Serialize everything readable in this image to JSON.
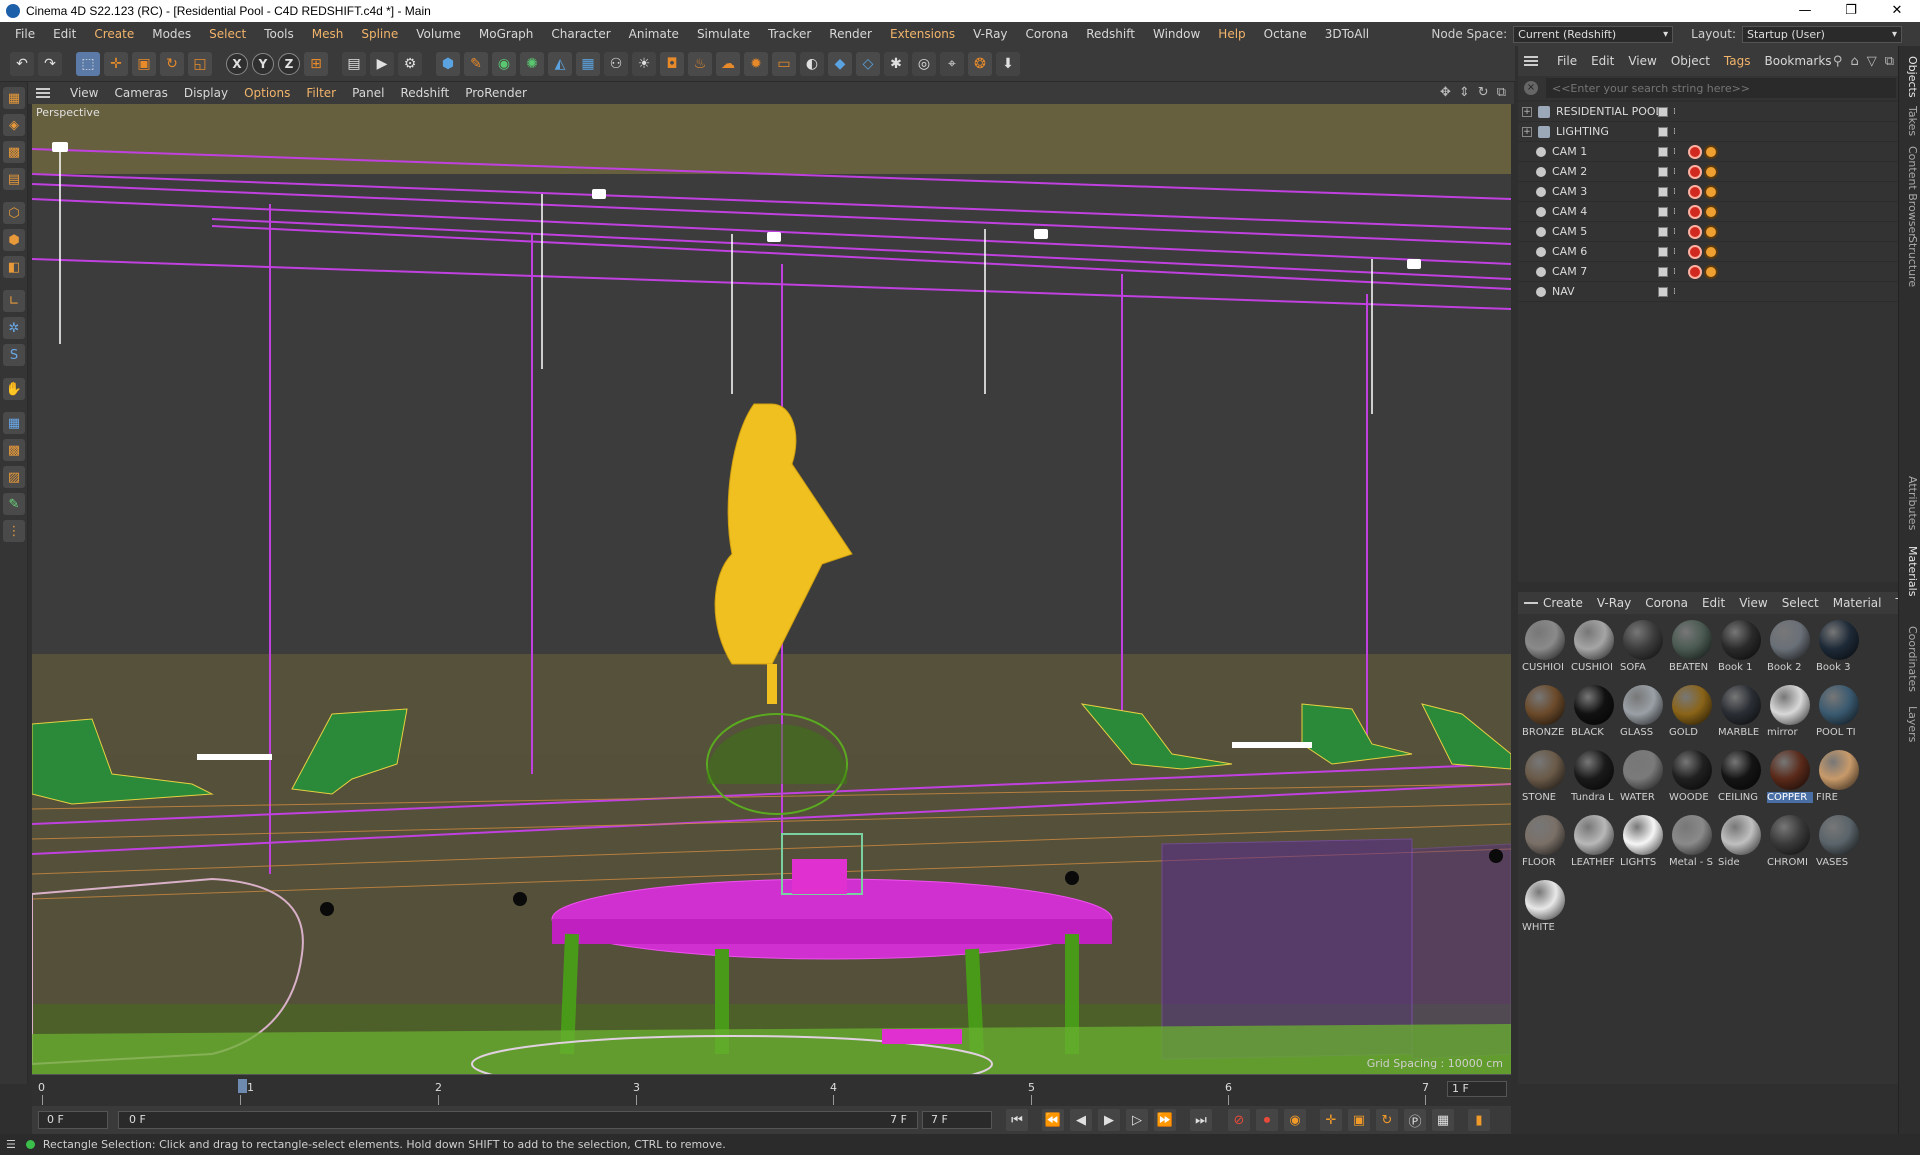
{
  "window": {
    "title": "Cinema 4D S22.123 (RC) - [Residential Pool - C4D REDSHIFT.c4d *] - Main",
    "controls": [
      "—",
      "❐",
      "✕"
    ]
  },
  "menubar": {
    "items": [
      "File",
      "Edit",
      "Create",
      "Modes",
      "Select",
      "Tools",
      "Mesh",
      "Spline",
      "Volume",
      "MoGraph",
      "Character",
      "Animate",
      "Simulate",
      "Tracker",
      "Render",
      "Extensions",
      "V-Ray",
      "Corona",
      "Redshift",
      "Window",
      "Help",
      "Octane",
      "3DToAll"
    ],
    "node_space_label": "Node Space:",
    "node_space_value": "Current (Redshift)",
    "layout_label": "Layout:",
    "layout_value": "Startup (User)"
  },
  "toolbar": {
    "axis": [
      "X",
      "Y",
      "Z"
    ]
  },
  "viewport": {
    "menu": [
      "View",
      "Cameras",
      "Display",
      "Options",
      "Filter",
      "Panel",
      "Redshift",
      "ProRender"
    ],
    "label": "Perspective",
    "grid_spacing": "Grid Spacing : 10000 cm"
  },
  "timeline": {
    "ticks": [
      "0",
      "1",
      "2",
      "3",
      "4",
      "5",
      "6",
      "7"
    ],
    "current_frame": "1 F",
    "playhead_frame": 1
  },
  "transport": {
    "start_field": "0 F",
    "range_start": "0 F",
    "range_end": "7 F",
    "end_field": "7 F"
  },
  "status": {
    "text": "Rectangle Selection: Click and drag to rectangle-select elements. Hold down SHIFT to add to the selection, CTRL to remove."
  },
  "object_manager": {
    "menu": [
      "File",
      "Edit",
      "View",
      "Object",
      "Tags",
      "Bookmarks"
    ],
    "search_placeholder": "<<Enter your search string here>>",
    "objects": [
      {
        "name": "RESIDENTIAL POOL",
        "type": "null",
        "tags": false
      },
      {
        "name": "LIGHTING",
        "type": "null",
        "tags": false
      },
      {
        "name": "CAM 1",
        "type": "camera",
        "tags": true
      },
      {
        "name": "CAM 2",
        "type": "camera",
        "tags": true
      },
      {
        "name": "CAM 3",
        "type": "camera",
        "tags": true
      },
      {
        "name": "CAM 4",
        "type": "camera",
        "tags": true
      },
      {
        "name": "CAM 5",
        "type": "camera",
        "tags": true
      },
      {
        "name": "CAM 6",
        "type": "camera",
        "tags": true
      },
      {
        "name": "CAM 7",
        "type": "camera",
        "tags": true
      },
      {
        "name": "NAV",
        "type": "camera",
        "tags": false
      }
    ]
  },
  "material_manager": {
    "menu": [
      "Create",
      "V-Ray",
      "Corona",
      "Edit",
      "View",
      "Select",
      "Material",
      "Textu"
    ],
    "selected": "COPPER",
    "materials": [
      {
        "name": "CUSHIOI",
        "color": "#8a8a8a"
      },
      {
        "name": "CUSHIOI",
        "color": "#a5a5a5"
      },
      {
        "name": "SOFA",
        "color": "#3c3c3c"
      },
      {
        "name": "BEATEN",
        "color": "#4a5a52"
      },
      {
        "name": "Book 1",
        "color": "#2a2a2a"
      },
      {
        "name": "Book 2",
        "color": "#6a7078"
      },
      {
        "name": "Book 3",
        "color": "#1e2a38"
      },
      {
        "name": "BRONZE",
        "color": "#6b4a2a"
      },
      {
        "name": "BLACK",
        "color": "#111111"
      },
      {
        "name": "GLASS",
        "color": "#9aa0a6"
      },
      {
        "name": "GOLD",
        "color": "#8a6418"
      },
      {
        "name": "MARBLE",
        "color": "#2a2e34"
      },
      {
        "name": "mirror",
        "color": "#d8d8d8"
      },
      {
        "name": "POOL TI",
        "color": "#3a5a70"
      },
      {
        "name": "STONE",
        "color": "#6a5a48"
      },
      {
        "name": "Tundra L",
        "color": "#1a1a1a"
      },
      {
        "name": "WATER",
        "color": "#7a7a7a"
      },
      {
        "name": "WOODE",
        "color": "#202020"
      },
      {
        "name": "CEILING",
        "color": "#141414"
      },
      {
        "name": "COPPER",
        "color": "#5a2a1a"
      },
      {
        "name": "FIRE",
        "color": "#c89a6a"
      },
      {
        "name": "FLOOR",
        "color": "#7a7068"
      },
      {
        "name": "LEATHEF",
        "color": "#b8b8b8"
      },
      {
        "name": "LIGHTS",
        "color": "#f6f6f6"
      },
      {
        "name": "Metal - S",
        "color": "#8a8a8a"
      },
      {
        "name": "Side",
        "color": "#c0c0c0"
      },
      {
        "name": "CHROMI",
        "color": "#3a3a3a"
      },
      {
        "name": "VASES",
        "color": "#5a646a"
      },
      {
        "name": "WHITE",
        "color": "#e8e8e8"
      }
    ]
  },
  "right_tabs": [
    "Objects",
    "Takes",
    "Content Browser",
    "Structure",
    "Attributes",
    "Materials",
    "Coordinates",
    "Layers"
  ]
}
